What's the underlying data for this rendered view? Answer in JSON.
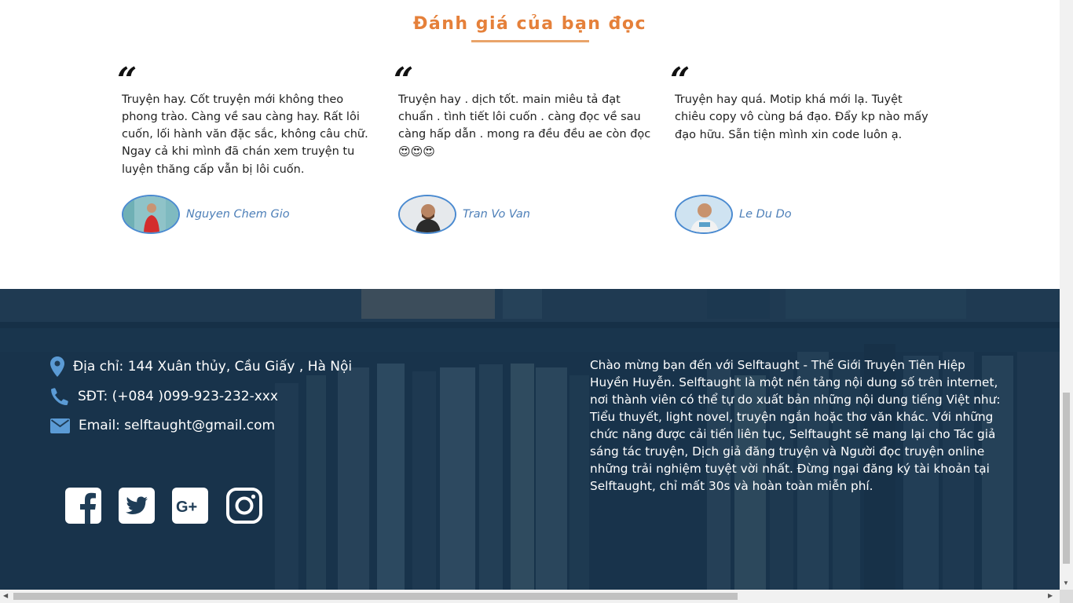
{
  "reviews_section": {
    "title": "Đánh giá của bạn đọc",
    "quote_glyph": "“",
    "items": [
      {
        "text": "Truyện hay. Cốt truyện mới không theo phong trào. Càng về sau càng hay. Rất lôi cuốn, lối hành văn đặc sắc, không câu chữ. Ngay cả khi mình đã chán xem truyện tu luyện thăng cấp vẫn bị lôi cuốn.",
        "emoji": "",
        "author": "Nguyen Chem Gio"
      },
      {
        "text": "Truyện hay . dịch tốt. main miêu tả đạt chuẩn . tình tiết lôi cuốn . càng đọc về sau càng hấp dẫn . mong ra đều đều ae còn đọc ",
        "emoji": "😍😍😍",
        "author": "Tran Vo Van"
      },
      {
        "text": "Truyện hay quá. Motip khá mới lạ. Tuyệt chiêu copy vô cùng bá đạo. Đẩy kp nào mấy đạo hữu. Sẵn tiện mình xin code luôn ạ.",
        "emoji": "",
        "author": "Le Du Do"
      }
    ]
  },
  "footer": {
    "address": "Địa chỉ: 144 Xuân thủy, Cầu Giấy , Hà Nội",
    "phone": "SĐT: (+084 )099-923-232-xxx",
    "email": "Email: selftaught@gmail.com",
    "social_icons": [
      "facebook-icon",
      "twitter-icon",
      "google-plus-icon",
      "instagram-icon"
    ],
    "about": "Chào mừng bạn đến với Selftaught - Thế Giới Truyện Tiên Hiệp Huyền Huyễn. Selftaught là một nền tảng nội dung số trên internet, nơi thành viên có thể tự do xuất bản những nội dung tiếng Việt như: Tiểu thuyết, light novel, truyện ngắn hoặc thơ văn khác. Với những chức năng được cải tiến liên tục, Selftaught sẽ mang lại cho Tác giả sáng tác truyện, Dịch giả đăng truyện và Người đọc truyện online những trải nghiệm tuyệt vời nhất. Đừng ngại đăng ký tài khoản tại Selftaught, chỉ mất 30s và hoàn toàn miễn phí."
  },
  "colors": {
    "title_accent": "#e5803a",
    "author_name": "#4d7fb8",
    "footer_background": "#1f3d57"
  }
}
